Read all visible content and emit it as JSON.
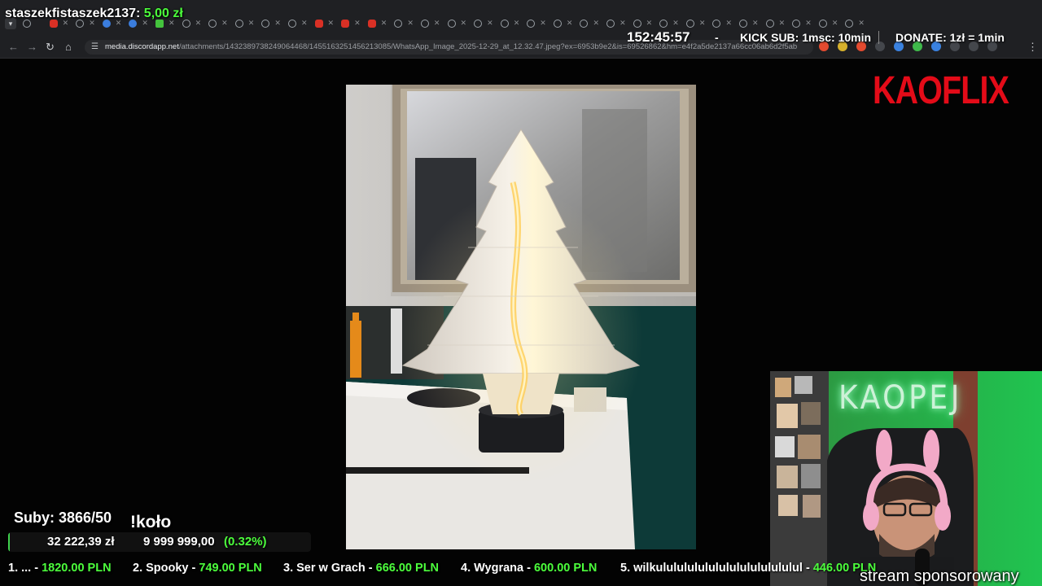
{
  "browser": {
    "url_host": "media.discordapp.net",
    "url_path": "/attachments/1432389738249064468/1455163251456213085/WhatsApp_Image_2025-12-29_at_12.32.47.jpeg?ex=6953b9e2&is=69526862&hm=e4f2a5de2137a66cc06ab6d2f5ab6..."
  },
  "stream": {
    "donor_name": "staszekfistaszek2137:",
    "donor_amount": "5,00 zł",
    "timer": "152:45:57",
    "separator": "-",
    "kick_sub": "KICK SUB: 1msc: 10min",
    "donate_rate": "DONATE: 1zł = 1min",
    "brand": "KAOFLIX",
    "webcam_neon": "KAOPEJ",
    "subs": "Suby: 3866/50",
    "wheel": "!koło",
    "goal": {
      "current": "32 222,39 zł",
      "target": "9 999 999,00",
      "percent_text": "(0.32%)",
      "fraction": 0.0032
    },
    "ticker": [
      {
        "name": "1. ... -",
        "value": "1820.00 PLN"
      },
      {
        "name": "2. Spooky -",
        "value": "749.00 PLN"
      },
      {
        "name": "3. Ser w Grach -",
        "value": "666.00 PLN"
      },
      {
        "name": "4. Wygrana -",
        "value": "600.00 PLN"
      },
      {
        "name": "5. wilkulululululululululululululul -",
        "value": "446.00 PLN"
      }
    ],
    "sponsor": "stream sponsorowany"
  },
  "icons": {
    "tab_chevron": "chevron-down-icon",
    "back": "arrow-left-icon",
    "forward": "arrow-right-icon",
    "reload": "reload-icon",
    "home": "home-icon",
    "site_info": "site-info-icon",
    "menu": "more-vertical-icon"
  },
  "colors": {
    "accent_green": "#4cff3c",
    "brand_red": "#e30b18",
    "chrome_bg": "#1f2023"
  }
}
